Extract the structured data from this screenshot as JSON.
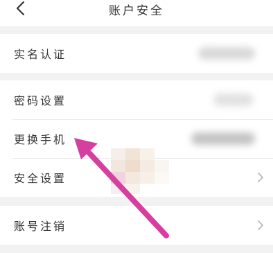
{
  "nav": {
    "title": "账户安全",
    "back_icon": "chevron-left-icon"
  },
  "groups": [
    {
      "rows": [
        {
          "label": "实名认证",
          "value_hidden": true
        }
      ]
    },
    {
      "rows": [
        {
          "label": "密码设置",
          "value_hidden": true
        },
        {
          "label": "更换手机",
          "value_hidden": true
        },
        {
          "label": "安全设置",
          "chevron_icon": "chevron-right-icon"
        }
      ]
    },
    {
      "rows": [
        {
          "label": "账号注销",
          "chevron_icon": "chevron-right-icon"
        }
      ]
    }
  ],
  "annotation": {
    "icon": "arrow-icon",
    "color": "#d63ea0",
    "points_to": "更换手机"
  },
  "colors": {
    "background": "#f2f2f2",
    "surface": "#ffffff",
    "text": "#333333",
    "chevron": "#b8b8b8"
  }
}
